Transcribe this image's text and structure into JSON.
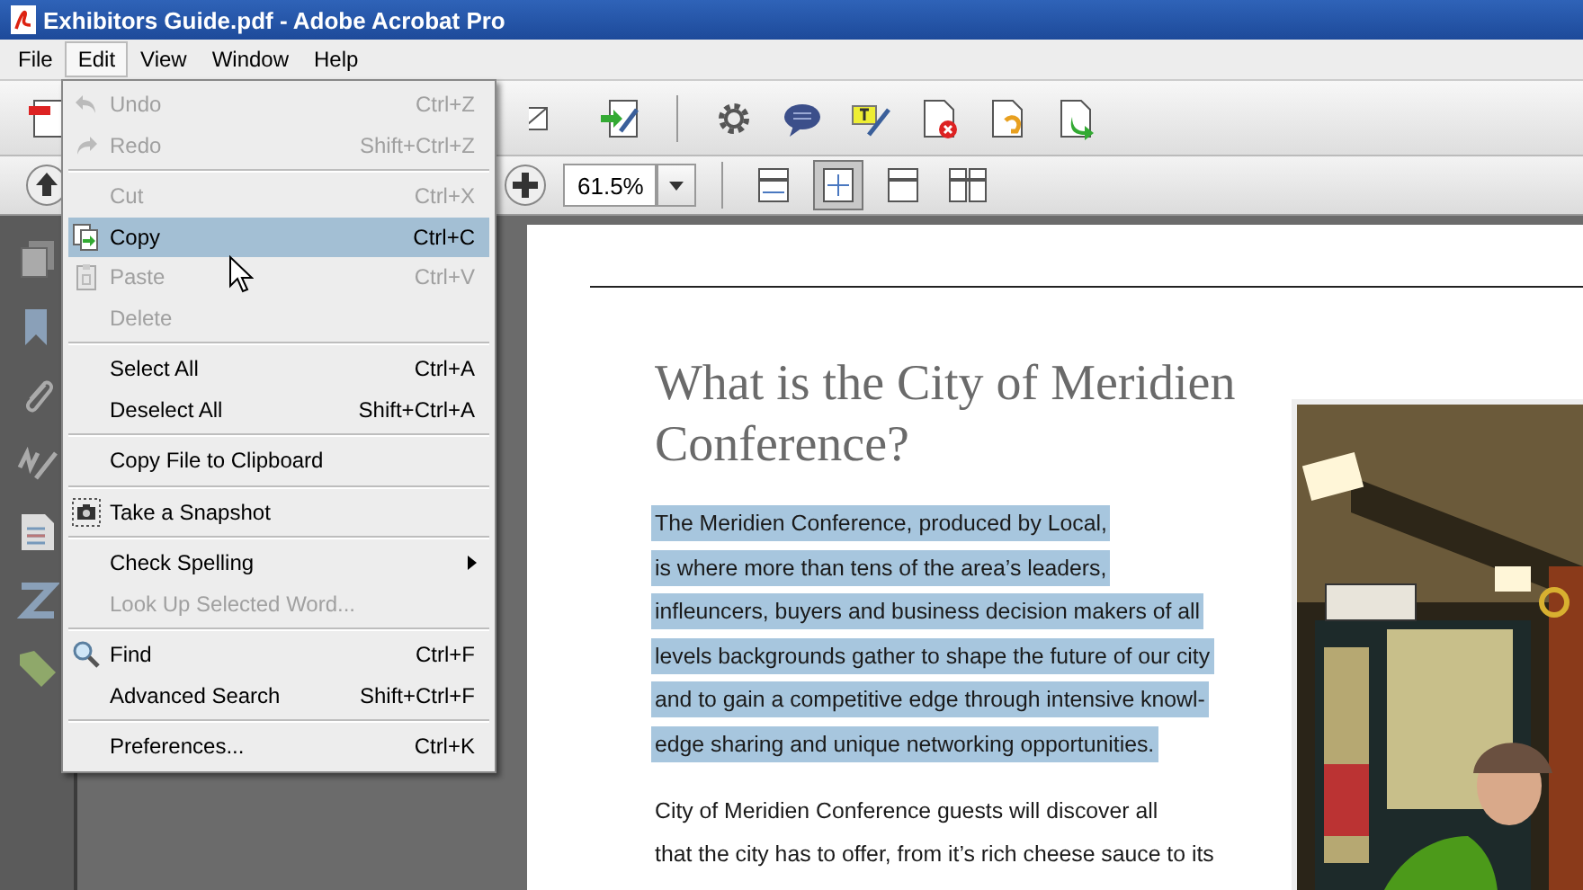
{
  "window": {
    "title": "Exhibitors Guide.pdf - Adobe Acrobat Pro"
  },
  "menu_bar": [
    {
      "label": "File",
      "selected": false
    },
    {
      "label": "Edit",
      "selected": true
    },
    {
      "label": "View",
      "selected": false
    },
    {
      "label": "Window",
      "selected": false
    },
    {
      "label": "Help",
      "selected": false
    }
  ],
  "edit_menu": {
    "groups": [
      [
        {
          "label": "Undo",
          "shortcut": "Ctrl+Z",
          "disabled": true,
          "selected": false
        },
        {
          "label": "Redo",
          "shortcut": "Shift+Ctrl+Z",
          "disabled": true,
          "selected": false
        }
      ],
      [
        {
          "label": "Cut",
          "shortcut": "Ctrl+X",
          "disabled": true,
          "selected": false
        },
        {
          "label": "Copy",
          "shortcut": "Ctrl+C",
          "disabled": false,
          "selected": true
        },
        {
          "label": "Paste",
          "shortcut": "Ctrl+V",
          "disabled": true,
          "selected": false
        },
        {
          "label": "Delete",
          "disabled": true,
          "selected": false
        }
      ],
      [
        {
          "label": "Select All",
          "shortcut": "Ctrl+A",
          "disabled": false,
          "selected": false
        },
        {
          "label": "Deselect All",
          "shortcut": "Shift+Ctrl+A",
          "disabled": false,
          "selected": false
        }
      ],
      [
        {
          "label": "Copy File to Clipboard",
          "disabled": false,
          "selected": false
        }
      ],
      [
        {
          "label": "Take a Snapshot",
          "disabled": false,
          "selected": false
        }
      ],
      [
        {
          "label": "Check Spelling",
          "disabled": false,
          "selected": false,
          "submenu": true
        },
        {
          "label": "Look Up Selected Word...",
          "disabled": true,
          "selected": false
        }
      ],
      [
        {
          "label": "Find",
          "shortcut": "Ctrl+F",
          "disabled": false,
          "selected": false
        },
        {
          "label": "Advanced Search",
          "shortcut": "Shift+Ctrl+F",
          "disabled": false,
          "selected": false
        }
      ],
      [
        {
          "label": "Preferences...",
          "shortcut": "Ctrl+K",
          "disabled": false,
          "selected": false
        }
      ]
    ]
  },
  "toolbar": {
    "zoom": "61.5%",
    "view_buttons": [
      {
        "selected": false
      },
      {
        "selected": true
      },
      {
        "selected": false
      },
      {
        "selected": false
      }
    ]
  },
  "document": {
    "heading": "What is the City of Meridien Conference?",
    "paragraphs": [
      {
        "selected": true,
        "lines": [
          "The Meridien Conference, produced by Local,",
          "is where more than tens of the area’s leaders,",
          "infleuncers, buyers and business decision makers of all",
          "levels backgrounds gather to shape the future of our city",
          "and to gain a competitive edge through intensive knowl-",
          "edge sharing and unique networking opportunities."
        ]
      },
      {
        "selected": false,
        "lines": [
          "City of Meridien Conference guests will discover all",
          "that the city has to offer, from it’s rich cheese sauce to its"
        ]
      }
    ]
  }
}
